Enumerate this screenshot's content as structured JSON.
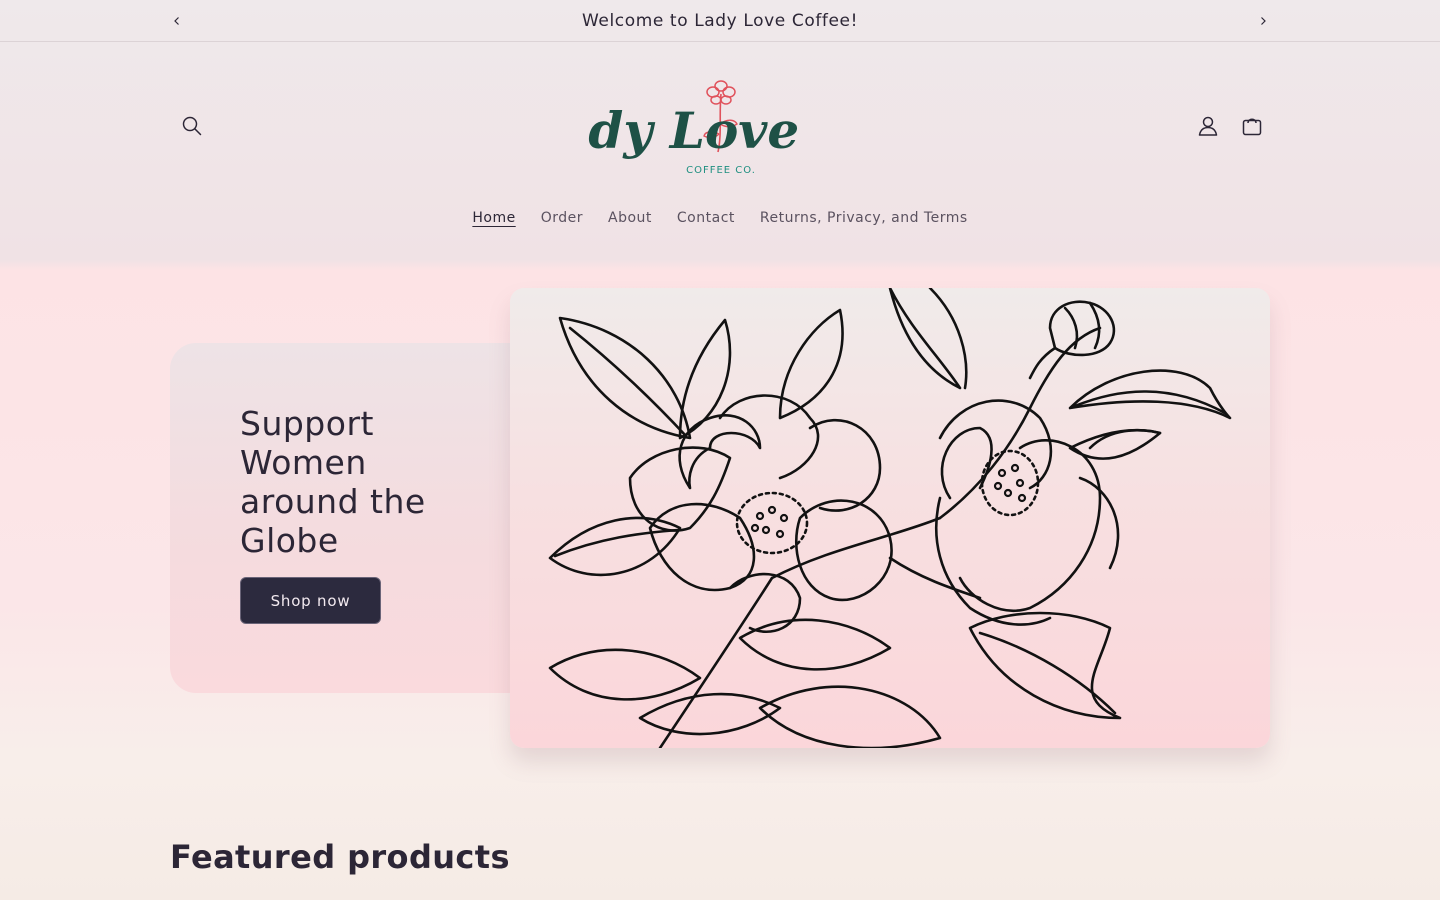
{
  "announcement": {
    "message": "Welcome to Lady Love Coffee!",
    "prev_icon": "chevron-left-icon",
    "next_icon": "chevron-right-icon"
  },
  "header": {
    "logo": {
      "text_main": "Lady Love",
      "text_sub": "COFFEE CO."
    },
    "icons": [
      "search-icon",
      "account-icon",
      "cart-icon"
    ]
  },
  "nav": {
    "items": [
      {
        "label": "Home",
        "active": true
      },
      {
        "label": "Order",
        "active": false
      },
      {
        "label": "About",
        "active": false
      },
      {
        "label": "Contact",
        "active": false
      },
      {
        "label": "Returns, Privacy, and Terms",
        "active": false
      }
    ]
  },
  "hero": {
    "title": "Support Women around the Globe",
    "button_label": "Shop now"
  },
  "featured": {
    "title": "Featured products"
  },
  "colors": {
    "text": "#2c2636",
    "button_bg": "#2c2a3e",
    "logo_green": "#1e5146",
    "logo_rose": "#e0525c"
  }
}
